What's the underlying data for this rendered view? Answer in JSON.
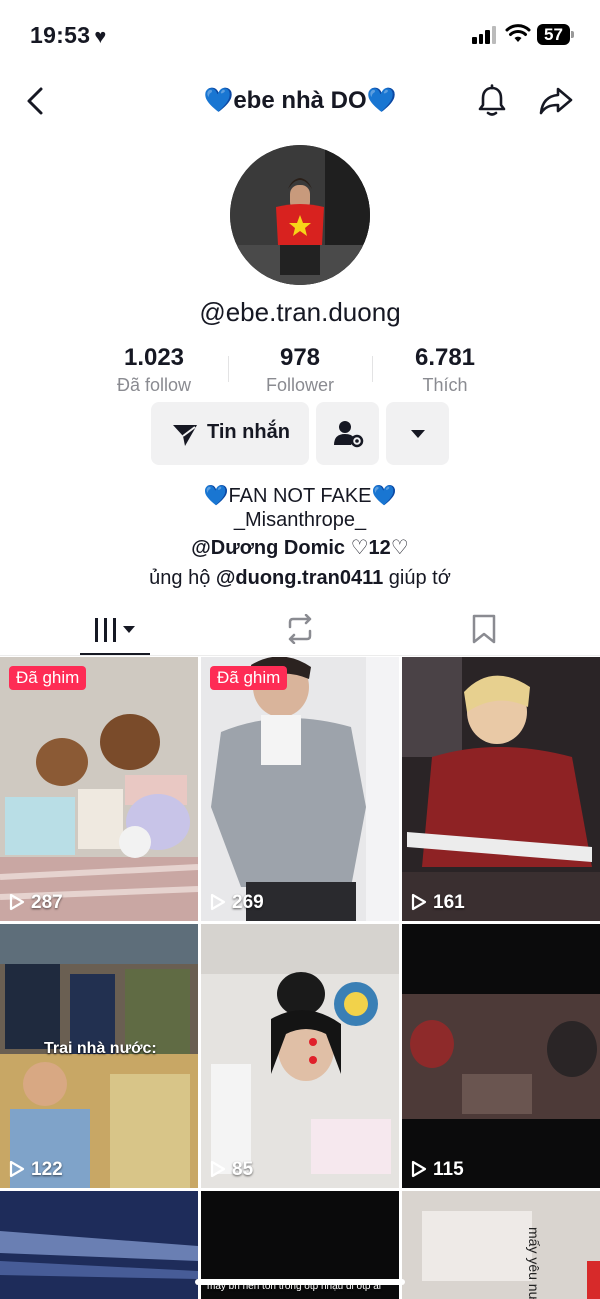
{
  "status_bar": {
    "time": "19:53",
    "battery": "57"
  },
  "header": {
    "title": "💙ebe nhà DO💙"
  },
  "profile": {
    "handle": "@ebe.tran.duong"
  },
  "stats": [
    {
      "value": "1.023",
      "label": "Đã follow"
    },
    {
      "value": "978",
      "label": "Follower"
    },
    {
      "value": "6.781",
      "label": "Thích"
    }
  ],
  "actions": {
    "message_label": "Tin nhắn"
  },
  "bio": {
    "line1": "💙FAN NOT FAKE💙",
    "line2": "_Misanthrope_",
    "line3": "@Dương Domic ♡12♡",
    "line4_prefix": "ủng hộ ",
    "line4_mention": "@duong.tran0411",
    "line4_suffix": " giúp tớ"
  },
  "videos": [
    {
      "views": "287",
      "pinned": "Đã ghim"
    },
    {
      "views": "269",
      "pinned": "Đã ghim"
    },
    {
      "views": "161"
    },
    {
      "views": "122",
      "overlay": "Trai nhà nước:"
    },
    {
      "views": "85"
    },
    {
      "views": "115"
    }
  ],
  "partial_row": {
    "cell2_caption": "mấy bn nên tốn trong otp nhậu đi otp ai",
    "cell3_caption": "mấy yêu nước"
  },
  "colors": {
    "accent": "#fe2c55",
    "text": "#161823",
    "secondary": "#8a8b91",
    "button_bg": "#f1f1f2"
  }
}
